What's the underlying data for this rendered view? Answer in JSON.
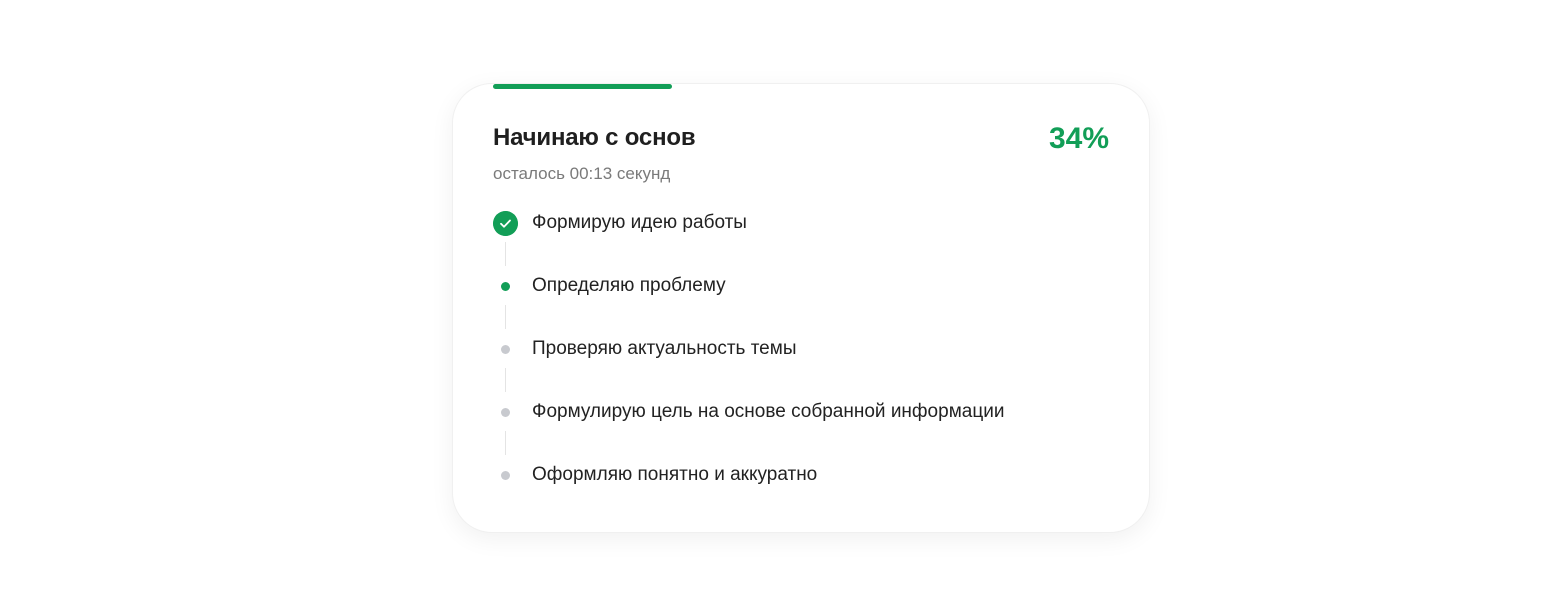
{
  "card": {
    "title": "Начинаю с основ",
    "percent_label": "34%",
    "progress": 0.29,
    "subtitle": "осталось 00:13 секунд",
    "colors": {
      "accent": "#129e57",
      "pending": "#c8cacf"
    },
    "steps": [
      {
        "label": "Формирую идею работы",
        "status": "done",
        "icon": "check-icon"
      },
      {
        "label": "Определяю проблему",
        "status": "active",
        "icon": "dot-icon"
      },
      {
        "label": "Проверяю актуальность темы",
        "status": "pending",
        "icon": "dot-icon"
      },
      {
        "label": "Формулирую цель на основе собранной информации",
        "status": "pending",
        "icon": "dot-icon"
      },
      {
        "label": "Оформляю понятно и аккуратно",
        "status": "pending",
        "icon": "dot-icon"
      }
    ]
  }
}
